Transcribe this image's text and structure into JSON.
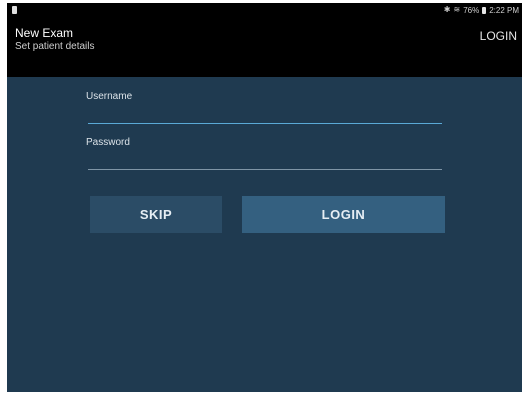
{
  "status_bar": {
    "icons": [
      "bluetooth-icon",
      "wifi-icon"
    ],
    "battery": "76%",
    "time": "2:22 PM"
  },
  "app_bar": {
    "title": "New Exam",
    "subtitle": "Set patient details",
    "login_action": "LOGIN"
  },
  "form": {
    "username_label": "Username",
    "username_value": "",
    "password_label": "Password",
    "password_value": ""
  },
  "buttons": {
    "skip": "SKIP",
    "login": "LOGIN"
  },
  "colors": {
    "background": "#1f3a50",
    "app_bar": "#000000",
    "focused_underline": "#5aa9d6",
    "unfocused_underline": "#7f95a6",
    "skip_button": "#2b4c66",
    "login_button": "#346080"
  }
}
